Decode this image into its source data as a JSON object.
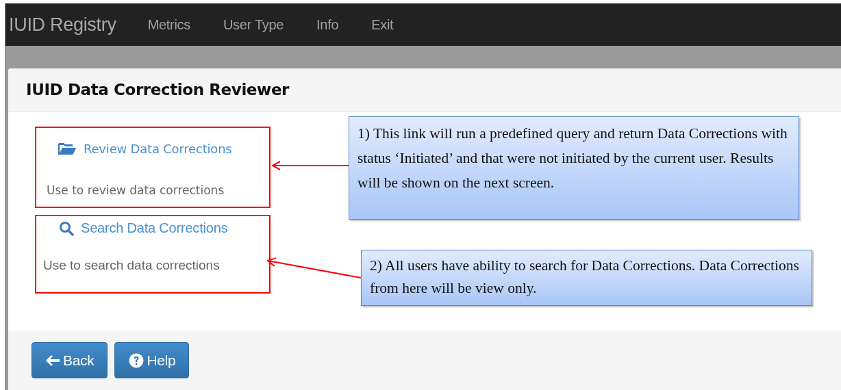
{
  "navbar": {
    "brand": "IUID Registry",
    "items": [
      "Metrics",
      "User Type",
      "Info",
      "Exit"
    ]
  },
  "panel": {
    "title": "IUID Data Correction Reviewer",
    "options": [
      {
        "kind": "review",
        "link": "Review Data Corrections",
        "description": "Use to review data corrections"
      },
      {
        "kind": "search",
        "link": "Search Data Corrections",
        "description": "Use to search data corrections"
      }
    ],
    "callouts": [
      {
        "text": "1) This link will run a predefined query and return Data Corrections with status ‘Initiated’ and that were not initiated by the current user. Results will be shown on the next screen."
      },
      {
        "text": "2) All users have ability to search for Data Corrections. Data Corrections from here will be view only."
      }
    ],
    "buttons": [
      {
        "kind": "back",
        "label": "Back"
      },
      {
        "kind": "help",
        "label": "Help"
      }
    ]
  }
}
